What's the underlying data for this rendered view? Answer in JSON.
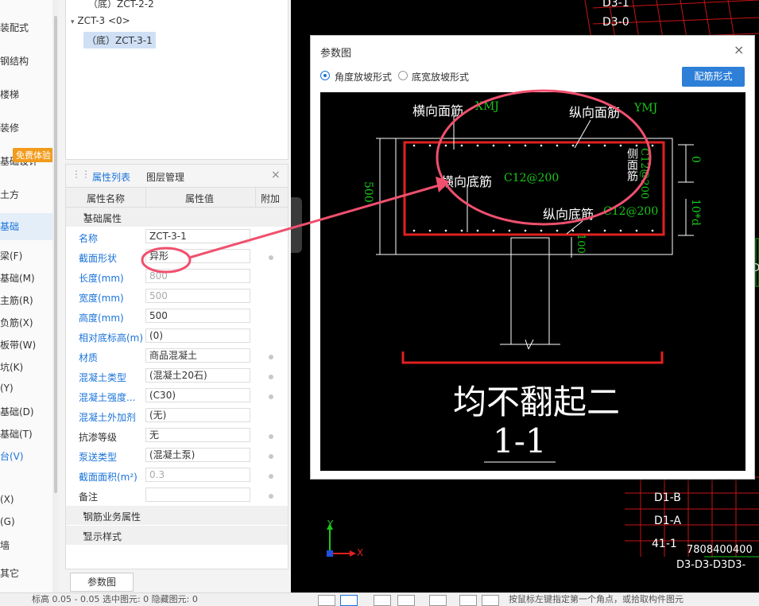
{
  "left_nav": {
    "items": [
      {
        "label": "装配式"
      },
      {
        "label": "钢结构"
      },
      {
        "label": "楼梯"
      },
      {
        "label": "装修"
      },
      {
        "label": "基础设计"
      },
      {
        "label": "土方"
      },
      {
        "label": "基础"
      },
      {
        "label": "梁(F)"
      },
      {
        "label": "基础(M)"
      },
      {
        "label": "主筋(R)"
      },
      {
        "label": "负筋(X)"
      },
      {
        "label": "板带(W)"
      },
      {
        "label": "坑(K)"
      },
      {
        "label": "(Y)"
      },
      {
        "label": "基础(D)"
      },
      {
        "label": "基础(T)"
      },
      {
        "label": "台(V)"
      },
      {
        "label": "(X)"
      },
      {
        "label": "(G)"
      },
      {
        "label": "墙"
      },
      {
        "label": "其它"
      }
    ],
    "badge": "免费体验"
  },
  "tree": {
    "rows": [
      {
        "label": "（底）ZCT-2-2"
      },
      {
        "label": "ZCT-3 <0>"
      },
      {
        "label": "（底）ZCT-3-1"
      }
    ]
  },
  "props": {
    "tabs": [
      "属性列表",
      "图层管理"
    ],
    "close": "×",
    "headers": [
      "属性名称",
      "属性值",
      "附加"
    ],
    "group_base": "基础属性",
    "rows": [
      {
        "name": "名称",
        "value": "ZCT-3-1"
      },
      {
        "name": "截面形状",
        "value": "异形"
      },
      {
        "name": "长度(mm)",
        "value": "800"
      },
      {
        "name": "宽度(mm)",
        "value": "500"
      },
      {
        "name": "高度(mm)",
        "value": "500"
      },
      {
        "name": "相对底标高(m)",
        "value": "(0)"
      },
      {
        "name": "材质",
        "value": "商品混凝土"
      },
      {
        "name": "混凝土类型",
        "value": "(混凝土20石)"
      },
      {
        "name": "混凝土强度...",
        "value": "(C30)"
      },
      {
        "name": "混凝土外加剂",
        "value": "(无)"
      },
      {
        "name": "抗渗等级",
        "value": "无"
      },
      {
        "name": "泵送类型",
        "value": "(混凝土泵)"
      },
      {
        "name": "截面面积(m²)",
        "value": "0.3"
      },
      {
        "name": "备注",
        "value": ""
      }
    ],
    "group_rebar": "钢筋业务属性",
    "group_display": "显示样式"
  },
  "param_button": "参数图",
  "status_bar": {
    "text": "标高  0.05 - 0.05    选中图元: 0    隐藏图元: 0",
    "hint": "按鼠标左键指定第一个角点，或拾取构件图元"
  },
  "dialog": {
    "title": "参数图",
    "close": "×",
    "radio_angle": "角度放坡形式",
    "radio_width": "底宽放坡形式",
    "rebar_button": "配筋形式",
    "drawing": {
      "label_xmj": "横向面筋",
      "code_xmj": "XMJ",
      "label_ymj": "纵向面筋",
      "code_ymj": "YMJ",
      "label_xdj": "横向底筋",
      "code_xdj": "C12@200",
      "label_ydj": "纵向底筋",
      "code_ydj": "C12@200",
      "label_side": "侧面筋",
      "code_side": "C12@200",
      "dim_left": "500",
      "dim_right_top": "0",
      "dim_right_bot": "10*d",
      "dim_bottom": "100",
      "big_text": "均不翻起二",
      "section": "1-1"
    }
  },
  "cad": {
    "labels": [
      "D3-1",
      "D3-0",
      "D1-B",
      "D1-A",
      "41-1",
      "7808400400",
      "D3-D3-D3D3-",
      "D"
    ],
    "axis_x": "X",
    "axis_y": "Y"
  },
  "colors": {
    "accent": "#1a73d9",
    "annotation": "#f0506e",
    "rebar": "#e02020",
    "cad_green": "#19c819"
  }
}
